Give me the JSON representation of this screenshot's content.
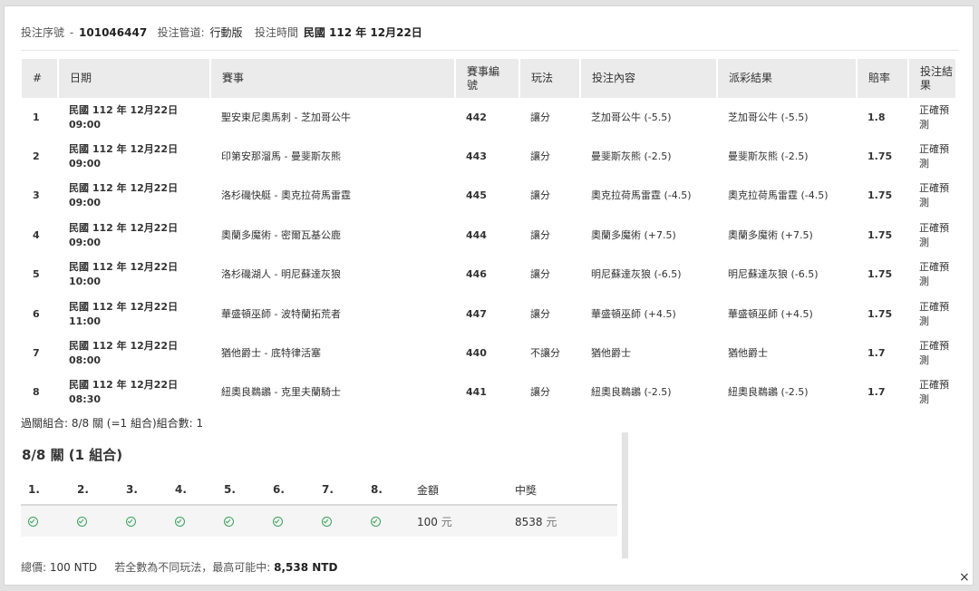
{
  "header": {
    "serial_label": "投注序號",
    "sep": "-",
    "serial_value": "101046447",
    "channel_label": "投注管道:",
    "channel_value": "行動版",
    "time_label": "投注時間",
    "time_value": "民國 112 年 12月22日"
  },
  "table": {
    "columns": [
      "#",
      "日期",
      "賽事",
      "賽事編號",
      "玩法",
      "投注內容",
      "派彩結果",
      "賠率",
      "投注結果"
    ],
    "column_break": [
      "賽事編",
      "號"
    ],
    "rows": [
      {
        "no": "1",
        "date": "民國 112 年 12月22日",
        "time": "09:00",
        "match": "聖安東尼奧馬刺 - 芝加哥公牛",
        "code": "442",
        "play": "讓分",
        "bet": "芝加哥公牛 (-5.5)",
        "payout": "芝加哥公牛 (-5.5)",
        "odds": "1.8",
        "result": "正確預測"
      },
      {
        "no": "2",
        "date": "民國 112 年 12月22日",
        "time": "09:00",
        "match": "印第安那溜馬 - 曼斐斯灰熊",
        "code": "443",
        "play": "讓分",
        "bet": "曼斐斯灰熊 (-2.5)",
        "payout": "曼斐斯灰熊 (-2.5)",
        "odds": "1.75",
        "result": "正確預測"
      },
      {
        "no": "3",
        "date": "民國 112 年 12月22日",
        "time": "09:00",
        "match": "洛杉磯快艇 - 奧克拉荷馬雷霆",
        "code": "445",
        "play": "讓分",
        "bet": "奧克拉荷馬雷霆 (-4.5)",
        "payout": "奧克拉荷馬雷霆 (-4.5)",
        "odds": "1.75",
        "result": "正確預測"
      },
      {
        "no": "4",
        "date": "民國 112 年 12月22日",
        "time": "09:00",
        "match": "奧蘭多魔術 - 密爾瓦基公鹿",
        "code": "444",
        "play": "讓分",
        "bet": "奧蘭多魔術 (+7.5)",
        "payout": "奧蘭多魔術 (+7.5)",
        "odds": "1.75",
        "result": "正確預測"
      },
      {
        "no": "5",
        "date": "民國 112 年 12月22日",
        "time": "10:00",
        "match": "洛杉磯湖人 - 明尼蘇達灰狼",
        "code": "446",
        "play": "讓分",
        "bet": "明尼蘇達灰狼 (-6.5)",
        "payout": "明尼蘇達灰狼 (-6.5)",
        "odds": "1.75",
        "result": "正確預測"
      },
      {
        "no": "6",
        "date": "民國 112 年 12月22日",
        "time": "11:00",
        "match": "華盛頓巫師 - 波特蘭拓荒者",
        "code": "447",
        "play": "讓分",
        "bet": "華盛頓巫師 (+4.5)",
        "payout": "華盛頓巫師 (+4.5)",
        "odds": "1.75",
        "result": "正確預測"
      },
      {
        "no": "7",
        "date": "民國 112 年 12月22日",
        "time": "08:00",
        "match": "猶他爵士 - 底特律活塞",
        "code": "440",
        "play": "不讓分",
        "bet": "猶他爵士",
        "payout": "猶他爵士",
        "odds": "1.7",
        "result": "正確預測"
      },
      {
        "no": "8",
        "date": "民國 112 年 12月22日",
        "time": "08:30",
        "match": "紐奧良鵜鶘 - 克里夫蘭騎士",
        "code": "441",
        "play": "讓分",
        "bet": "紐奧良鵜鶘 (-2.5)",
        "payout": "紐奧良鵜鶘 (-2.5)",
        "odds": "1.7",
        "result": "正確預測"
      }
    ]
  },
  "summary": "過關組合: 8/8 關 (=1 組合)組合數: 1",
  "combo": {
    "title": "8/8 關 (1 組合)",
    "headers": [
      "1.",
      "2.",
      "3.",
      "4.",
      "5.",
      "6.",
      "7.",
      "8."
    ],
    "amount_label": "金額",
    "prize_label": "中獎",
    "amount_value": "100",
    "prize_value": "8538",
    "unit": "元",
    "icon": "check-circle-icon",
    "check_color": "#3aa35b"
  },
  "footer": {
    "total_label": "總價:",
    "total_value": "100 NTD",
    "note": "若全數為不同玩法，最高可能中:",
    "max_value": "8,538 NTD"
  },
  "close": "×"
}
